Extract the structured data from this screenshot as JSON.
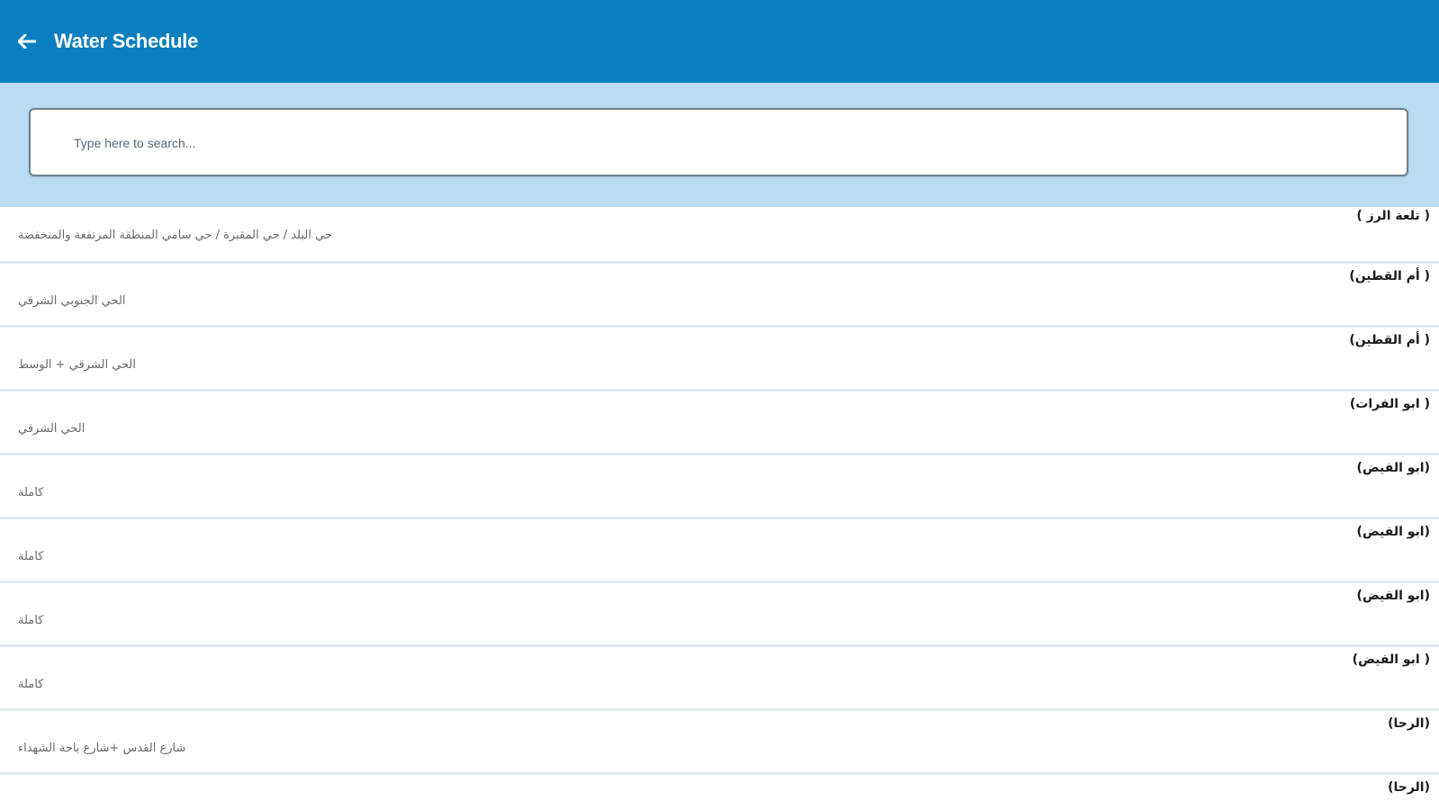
{
  "header": {
    "title": "Water Schedule",
    "back_icon": "arrow-left-icon",
    "bg_color": "#0b7fbf"
  },
  "search": {
    "placeholder": "Type here to search...",
    "value": "",
    "band_color": "#b9dcf1"
  },
  "list": {
    "items": [
      {
        "title": "( تلعة الرز )",
        "subtitle": "حي البلد / حي المقبرة / حي سامي المنطقة المرتفعة والمنخفضة"
      },
      {
        "title": "( أم القطين)",
        "subtitle": "الحي الجنوبي الشرقي"
      },
      {
        "title": "( أم القطين)",
        "subtitle": "الحي الشرقي + الوسط"
      },
      {
        "title": "( ابو الفرات)",
        "subtitle": "الحي الشرقي"
      },
      {
        "title": "(ابو الفيض)",
        "subtitle": "كاملة"
      },
      {
        "title": "(ابو الفيض)",
        "subtitle": "كاملة"
      },
      {
        "title": "(ابو الفيض)",
        "subtitle": "كاملة"
      },
      {
        "title": "( ابو الفيض)",
        "subtitle": "كاملة"
      },
      {
        "title": "(الرحا)",
        "subtitle": "شارع القدس +شارع باحة الشهداء"
      },
      {
        "title": "(الرحا)",
        "subtitle": ""
      }
    ]
  }
}
